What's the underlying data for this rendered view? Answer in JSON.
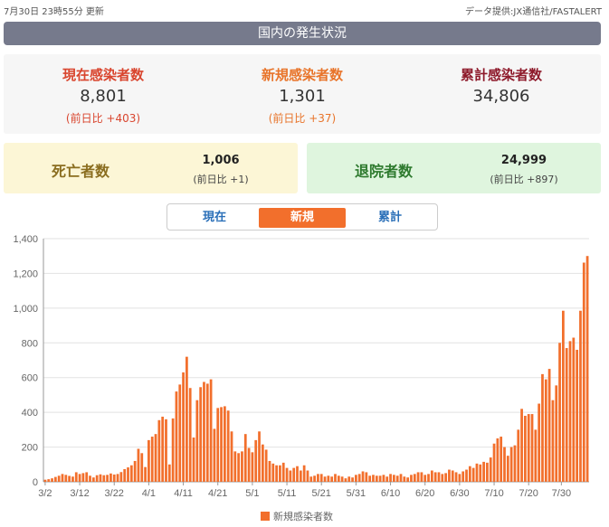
{
  "topbar": {
    "updated": "7月30日 23時55分 更新",
    "source": "データ提供:JX通信社/FASTALERT"
  },
  "header": {
    "title": "国内の発生状況"
  },
  "stats": {
    "current": {
      "label": "現在感染者数",
      "value": "8,801",
      "diff": "(前日比 +403)"
    },
    "new": {
      "label": "新規感染者数",
      "value": "1,301",
      "diff": "(前日比 +37)"
    },
    "total": {
      "label": "累計感染者数",
      "value": "34,806"
    }
  },
  "deaths": {
    "label": "死亡者数",
    "value": "1,006",
    "diff": "(前日比 +1)"
  },
  "recovered": {
    "label": "退院者数",
    "value": "24,999",
    "diff": "(前日比 +897)"
  },
  "tabs": [
    {
      "label": "現在",
      "active": false
    },
    {
      "label": "新規",
      "active": true
    },
    {
      "label": "累計",
      "active": false
    }
  ],
  "colors": {
    "bar": "#f26f2c",
    "grid": "#e2e2e2",
    "axis": "#999999"
  },
  "chart_data": {
    "type": "bar",
    "series": [
      {
        "name": "新規感染者数",
        "values": [
          12,
          15,
          20,
          28,
          35,
          45,
          40,
          34,
          30,
          55,
          45,
          50,
          55,
          35,
          25,
          38,
          43,
          38,
          40,
          48,
          42,
          45,
          56,
          73,
          83,
          95,
          120,
          190,
          165,
          85,
          240,
          260,
          275,
          355,
          375,
          360,
          100,
          365,
          520,
          560,
          630,
          720,
          540,
          255,
          470,
          545,
          575,
          565,
          590,
          305,
          425,
          430,
          435,
          410,
          290,
          175,
          165,
          175,
          275,
          195,
          170,
          240,
          290,
          215,
          185,
          120,
          105,
          95,
          95,
          110,
          80,
          65,
          80,
          90,
          65,
          95,
          65,
          30,
          35,
          45,
          45,
          30,
          35,
          30,
          45,
          35,
          30,
          20,
          30,
          25,
          40,
          45,
          60,
          55,
          35,
          40,
          35,
          35,
          40,
          30,
          45,
          40,
          35,
          45,
          30,
          25,
          40,
          45,
          55,
          55,
          40,
          45,
          65,
          55,
          55,
          45,
          50,
          70,
          65,
          55,
          45,
          60,
          70,
          90,
          80,
          105,
          100,
          115,
          110,
          140,
          220,
          250,
          260,
          200,
          150,
          200,
          210,
          300,
          420,
          380,
          390,
          390,
          300,
          450,
          620,
          590,
          650,
          470,
          555,
          800,
          985,
          770,
          810,
          830,
          760,
          985,
          1262,
          1300
        ]
      }
    ],
    "x_tick_labels": [
      "3/2",
      "3/12",
      "3/22",
      "4/1",
      "4/11",
      "4/21",
      "5/1",
      "5/11",
      "5/21",
      "5/31",
      "6/10",
      "6/20",
      "6/30",
      "7/10",
      "7/20",
      "7/30"
    ],
    "y_ticks": [
      0,
      200,
      400,
      600,
      800,
      1000,
      1200,
      1400
    ],
    "y_tick_labels": [
      "0",
      "200",
      "400",
      "600",
      "800",
      "1,000",
      "1,200",
      "1,400"
    ],
    "ylim": [
      0,
      1400
    ],
    "grid": true,
    "legend": "bottom-center"
  }
}
